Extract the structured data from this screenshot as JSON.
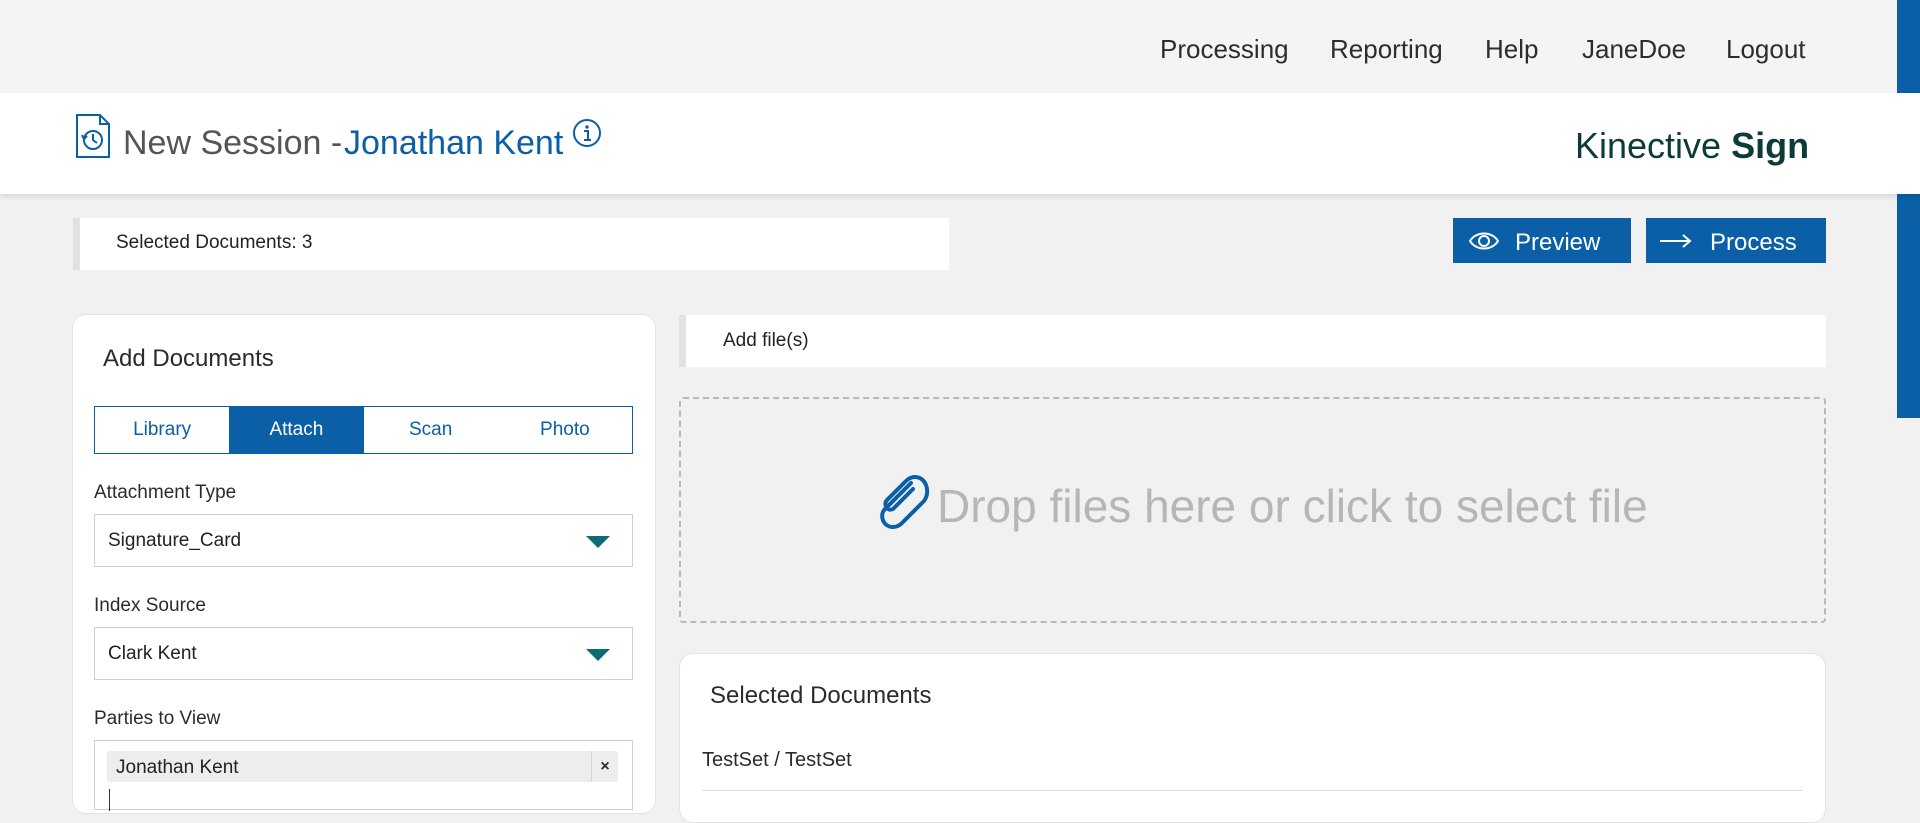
{
  "topnav": {
    "items": [
      {
        "label": "Processing"
      },
      {
        "label": "Reporting"
      },
      {
        "label": "Help"
      },
      {
        "label": "JaneDoe"
      },
      {
        "label": "Logout"
      }
    ]
  },
  "header": {
    "title_prefix": "New Session - ",
    "title_name": "Jonathan Kent",
    "brand_light": "Kinective ",
    "brand_bold": "Sign",
    "session_icon": "document-history-icon",
    "info_icon": "info-icon"
  },
  "selected_bar": {
    "text": "Selected Documents: 3"
  },
  "actions": {
    "preview": {
      "label": "Preview",
      "icon": "eye-icon"
    },
    "process": {
      "label": "Process",
      "icon": "arrow-right-icon"
    }
  },
  "add_documents": {
    "title": "Add Documents",
    "tabs": [
      {
        "label": "Library",
        "active": false
      },
      {
        "label": "Attach",
        "active": true
      },
      {
        "label": "Scan",
        "active": false
      },
      {
        "label": "Photo",
        "active": false
      }
    ],
    "attachment_type": {
      "label": "Attachment Type",
      "value": "Signature_Card"
    },
    "index_source": {
      "label": "Index Source",
      "value": "Clark Kent"
    },
    "parties": {
      "label": "Parties to View",
      "chips": [
        "Jonathan Kent"
      ],
      "remove": "×"
    }
  },
  "add_files": {
    "label": "Add file(s)",
    "drop_text": "Drop files here or click to select file",
    "drop_icon": "paperclip-icon"
  },
  "selected_documents": {
    "title": "Selected Documents",
    "set_name": "TestSet / TestSet"
  },
  "colors": {
    "accent": "#0b5fa6",
    "brand": "#0d3b3a",
    "caret": "#0e6b74"
  }
}
